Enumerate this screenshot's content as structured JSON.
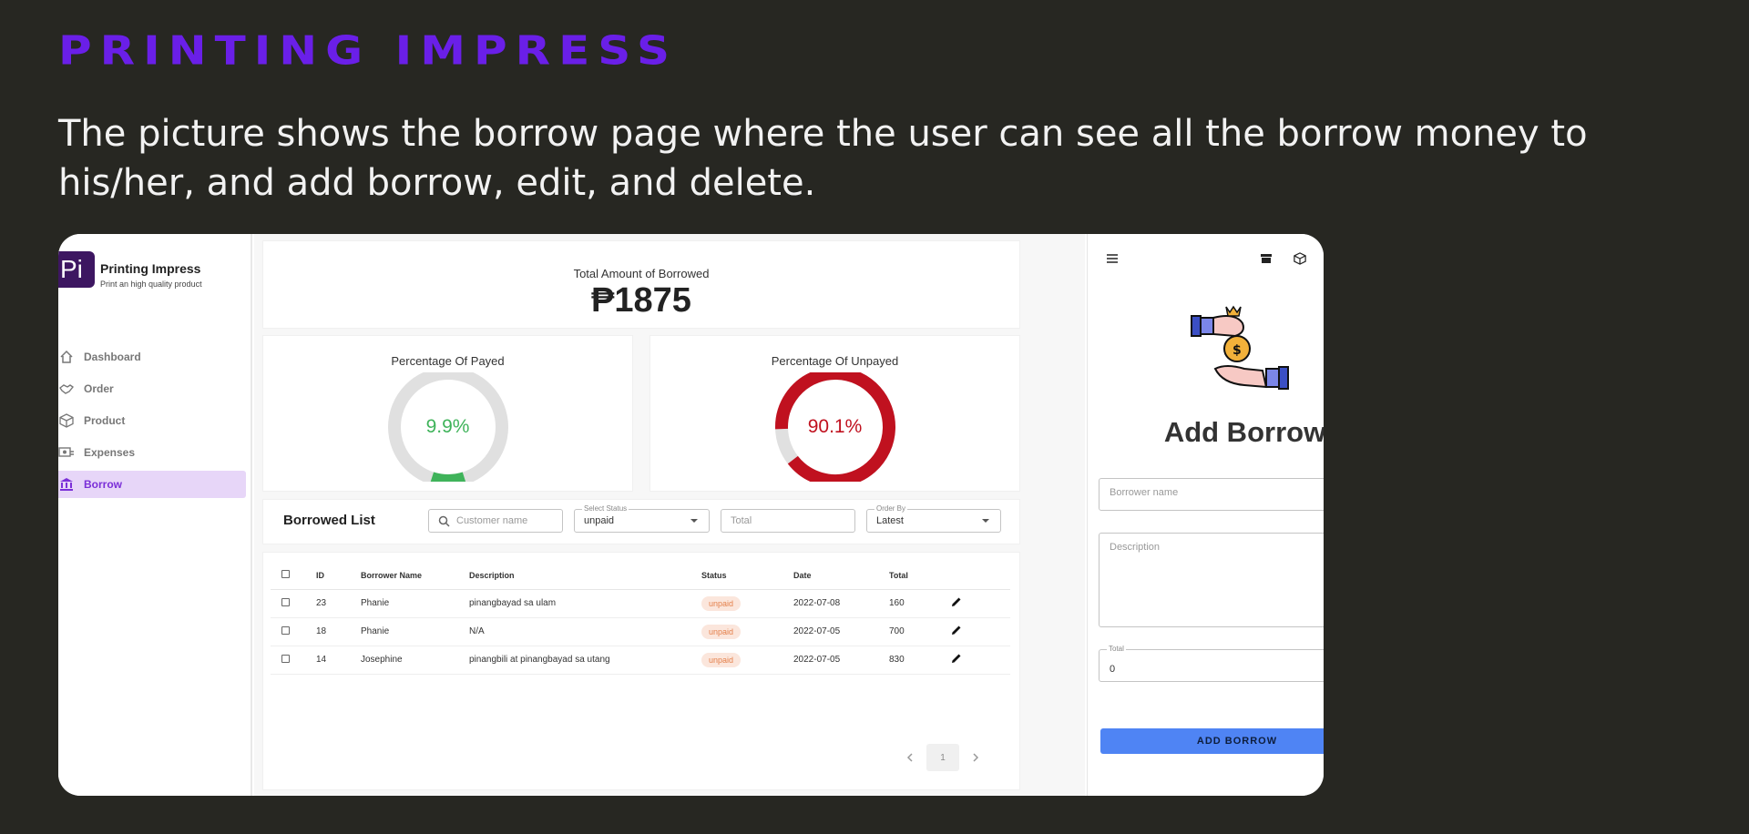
{
  "slide": {
    "title": "PRINTING IMPRESS",
    "description": "The picture shows the borrow page where the user can see all the borrow money to his/her, and add borrow, edit, and delete."
  },
  "brand": {
    "logo_text": "Pi",
    "name": "Printing Impress",
    "tagline": "Print an high quality product",
    "color": "#3d1661"
  },
  "sidebar": {
    "items": [
      {
        "label": "Dashboard",
        "icon": "home-icon"
      },
      {
        "label": "Order",
        "icon": "handshake-icon"
      },
      {
        "label": "Product",
        "icon": "box-icon"
      },
      {
        "label": "Expenses",
        "icon": "money-icon"
      },
      {
        "label": "Borrow",
        "icon": "bank-icon",
        "active": true
      }
    ]
  },
  "summary": {
    "total_label": "Total Amount of Borrowed",
    "total_value": "₱1875"
  },
  "payed": {
    "label": "Percentage Of Payed",
    "value_text": "9.9%",
    "percent": 9.9,
    "color": "#3fb35a"
  },
  "unpayed": {
    "label": "Percentage Of Unpayed",
    "value_text": "90.1%",
    "percent": 90.1,
    "color": "#c0111f"
  },
  "list": {
    "title": "Borrowed List",
    "search_placeholder": "Customer name",
    "status_label": "Select Status",
    "status_value": "unpaid",
    "total_placeholder": "Total",
    "order_label": "Order By",
    "order_value": "Latest"
  },
  "table": {
    "headers": [
      "ID",
      "Borrower Name",
      "Description",
      "Status",
      "Date",
      "Total"
    ],
    "rows": [
      {
        "id": "23",
        "name": "Phanie",
        "description": "pinangbayad sa ulam",
        "status": "unpaid",
        "date": "2022-07-08",
        "total": "160"
      },
      {
        "id": "18",
        "name": "Phanie",
        "description": "N/A",
        "status": "unpaid",
        "date": "2022-07-05",
        "total": "700"
      },
      {
        "id": "14",
        "name": "Josephine",
        "description": "pinangbili at pinangbayad sa utang",
        "status": "unpaid",
        "date": "2022-07-05",
        "total": "830"
      }
    ]
  },
  "pagination": {
    "current": "1"
  },
  "form": {
    "title": "Add Borrow",
    "name_placeholder": "Borrower name",
    "description_placeholder": "Description",
    "total_label": "Total",
    "total_value": "0",
    "submit_label": "ADD BORROW",
    "button_color": "#4f84f4"
  },
  "colors": {
    "accent": "#6a1fe8",
    "active_nav_bg": "#e7d6f8",
    "background": "#272722"
  }
}
